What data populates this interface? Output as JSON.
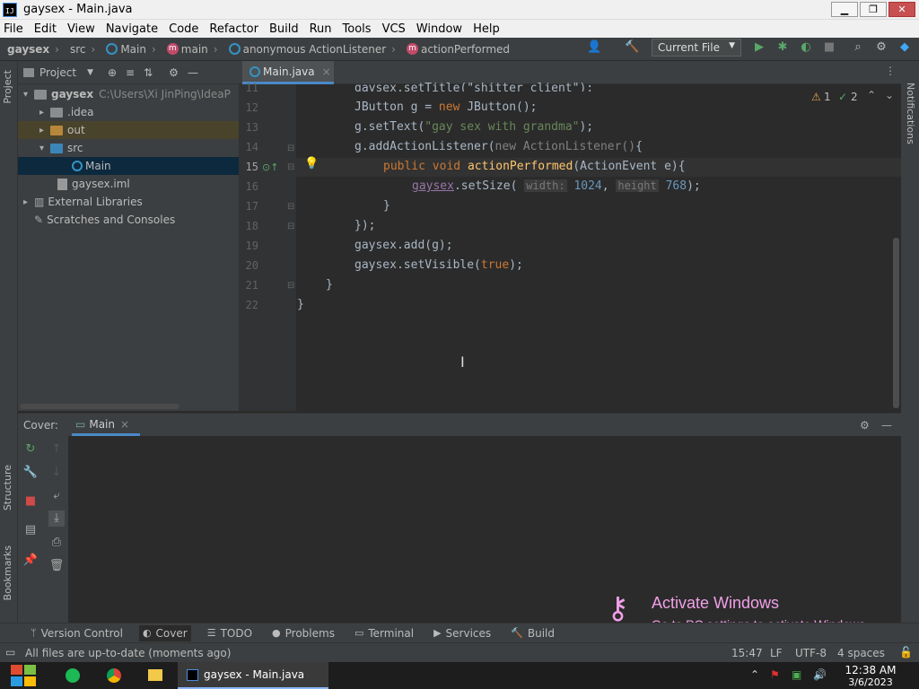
{
  "window": {
    "title": "gaysex - Main.java",
    "min": "▁",
    "max": "❐",
    "close": "✕"
  },
  "menu": [
    "File",
    "Edit",
    "View",
    "Navigate",
    "Code",
    "Refactor",
    "Build",
    "Run",
    "Tools",
    "VCS",
    "Window",
    "Help"
  ],
  "breadcrumb": {
    "project": "gaysex",
    "src": "src",
    "class": "Main",
    "method": "main",
    "anon": "anonymous ActionListener",
    "action": "actionPerformed"
  },
  "toolbar": {
    "run_config": "Current File",
    "run_config_arrow": "▼"
  },
  "project_panel": {
    "title": "Project",
    "tree": [
      {
        "label": "gaysex",
        "suffix": "C:\\Users\\Xi JinPing\\IdeaP"
      },
      {
        "label": ".idea"
      },
      {
        "label": "out"
      },
      {
        "label": "src"
      },
      {
        "label": "Main"
      },
      {
        "label": "gaysex.iml"
      },
      {
        "label": "External Libraries"
      },
      {
        "label": "Scratches and Consoles"
      }
    ]
  },
  "editor": {
    "tab": "Main.java",
    "inspections": {
      "warnings": "1",
      "ok": "2"
    },
    "lines": [
      {
        "n": "11"
      },
      {
        "n": "12"
      },
      {
        "n": "13"
      },
      {
        "n": "14"
      },
      {
        "n": "15"
      },
      {
        "n": "16"
      },
      {
        "n": "17"
      },
      {
        "n": "18"
      },
      {
        "n": "19"
      },
      {
        "n": "20"
      },
      {
        "n": "21"
      },
      {
        "n": "22"
      }
    ],
    "code": {
      "l11": "gaysex.setTitle(\"shitter client\");",
      "l12a": "JButton g = ",
      "l12b": "new",
      "l12c": " JButton();",
      "l13a": "g.setText(",
      "l13b": "\"gay sex with grandma\"",
      "l13c": ");",
      "l14a": "g.addActionListener(",
      "l14b": "new ActionListener()",
      "l14c": "{",
      "l15a": "public",
      "l15b": " void ",
      "l15c": "actionPerformed",
      "l15d": "(ActionEvent e){",
      "l16a": "gaysex",
      "l16b": ".setSize( ",
      "l16h1": "width:",
      "l16v1": "1024",
      "l16c": ", ",
      "l16h2": "height",
      "l16v2": "768",
      "l16d": ");",
      "l17": "}",
      "l18a": "});",
      "l19": "gaysex.add(g);",
      "l20a": "gaysex.setVisible(",
      "l20b": "true",
      "l20c": ");",
      "l21": "}",
      "l22": "}"
    }
  },
  "bottom_panel": {
    "label": "Cover:",
    "tab": "Main"
  },
  "tool_windows": [
    "Version Control",
    "Cover",
    "TODO",
    "Problems",
    "Terminal",
    "Services",
    "Build"
  ],
  "side_labels": {
    "project": "Project",
    "structure": "Structure",
    "bookmarks": "Bookmarks",
    "notifications": "Notifications"
  },
  "status": {
    "message": "All files are up-to-date (moments ago)",
    "position": "15:47",
    "line_sep": "LF",
    "encoding": "UTF-8",
    "indent": "4 spaces"
  },
  "watermark": {
    "line1": "Activate Windows",
    "line2": "Go to PC settings to activate Windows."
  },
  "taskbar": {
    "app": "gaysex - Main.java",
    "time": "12:38 AM",
    "date": "3/6/2023"
  }
}
